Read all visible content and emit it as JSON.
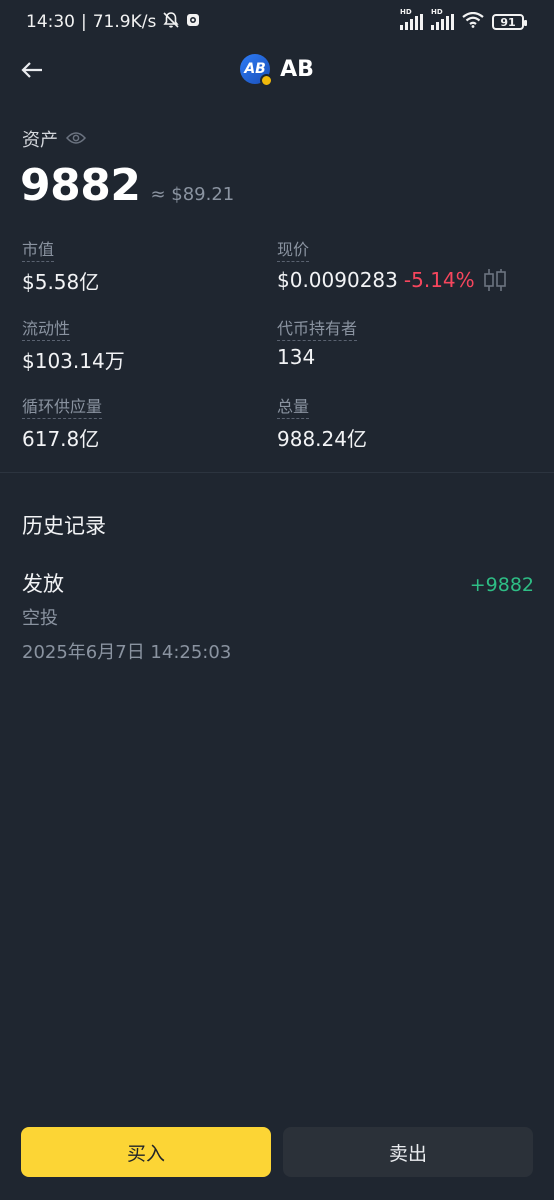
{
  "status_bar": {
    "time": "14:30",
    "separator": "|",
    "net_speed": "71.9K/s",
    "battery": "91",
    "hd1": "HD",
    "hd2": "HD"
  },
  "header": {
    "token_symbol": "AB",
    "logo_text": "AB"
  },
  "assets": {
    "label": "资产",
    "amount": "9882",
    "usd_value": "≈ $89.21"
  },
  "stats": {
    "market_cap": {
      "label": "市值",
      "value": "$5.58亿"
    },
    "price": {
      "label": "现价",
      "value": "$0.0090283",
      "change": "-5.14%"
    },
    "liquidity": {
      "label": "流动性",
      "value": "$103.14万"
    },
    "holders": {
      "label": "代币持有者",
      "value": "134"
    },
    "circulating_supply": {
      "label": "循环供应量",
      "value": "617.8亿"
    },
    "total_supply": {
      "label": "总量",
      "value": "988.24亿"
    }
  },
  "history": {
    "title": "历史记录",
    "items": [
      {
        "type": "发放",
        "subtype": "空投",
        "time": "2025年6月7日 14:25:03",
        "amount": "+9882"
      }
    ]
  },
  "actions": {
    "buy_label": "买入",
    "sell_label": "卖出"
  },
  "colors": {
    "background": "#1f2630",
    "accent_yellow": "#fcd535",
    "negative": "#f6465d",
    "positive": "#2ebd85"
  }
}
